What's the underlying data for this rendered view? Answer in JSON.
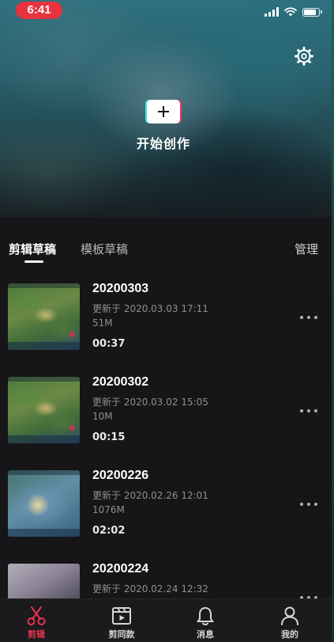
{
  "status_bar": {
    "time": "6:41",
    "icons": [
      "signal-icon",
      "wifi-icon",
      "battery-icon"
    ]
  },
  "hero": {
    "settings_icon": "gear-icon",
    "create_icon": "plus-icon",
    "create_label": "开始创作"
  },
  "tabs": {
    "items": [
      {
        "label": "剪辑草稿",
        "active": true
      },
      {
        "label": "模板草稿",
        "active": false
      }
    ],
    "manage_label": "管理"
  },
  "drafts": [
    {
      "title": "20200303",
      "updated": "更新于 2020.03.03 17:11",
      "size": "51M",
      "duration": "00:37",
      "thumb": "map"
    },
    {
      "title": "20200302",
      "updated": "更新于 2020.03.02 15:05",
      "size": "10M",
      "duration": "00:15",
      "thumb": "map"
    },
    {
      "title": "20200226",
      "updated": "更新于 2020.02.26 12:01",
      "size": "1076M",
      "duration": "02:02",
      "thumb": "arena"
    },
    {
      "title": "20200224",
      "updated": "更新于 2020.02.24 12:32",
      "size": "",
      "duration": "",
      "thumb": "photo"
    }
  ],
  "nav": {
    "items": [
      {
        "label": "剪辑",
        "icon": "scissors-icon",
        "active": true
      },
      {
        "label": "剪同款",
        "icon": "clapperboard-icon",
        "active": false
      },
      {
        "label": "消息",
        "icon": "bell-icon",
        "active": false
      },
      {
        "label": "我的",
        "icon": "user-icon",
        "active": false
      }
    ]
  },
  "colors": {
    "accent": "#e8344e",
    "background": "#161517",
    "time_pill": "#e8323f"
  }
}
